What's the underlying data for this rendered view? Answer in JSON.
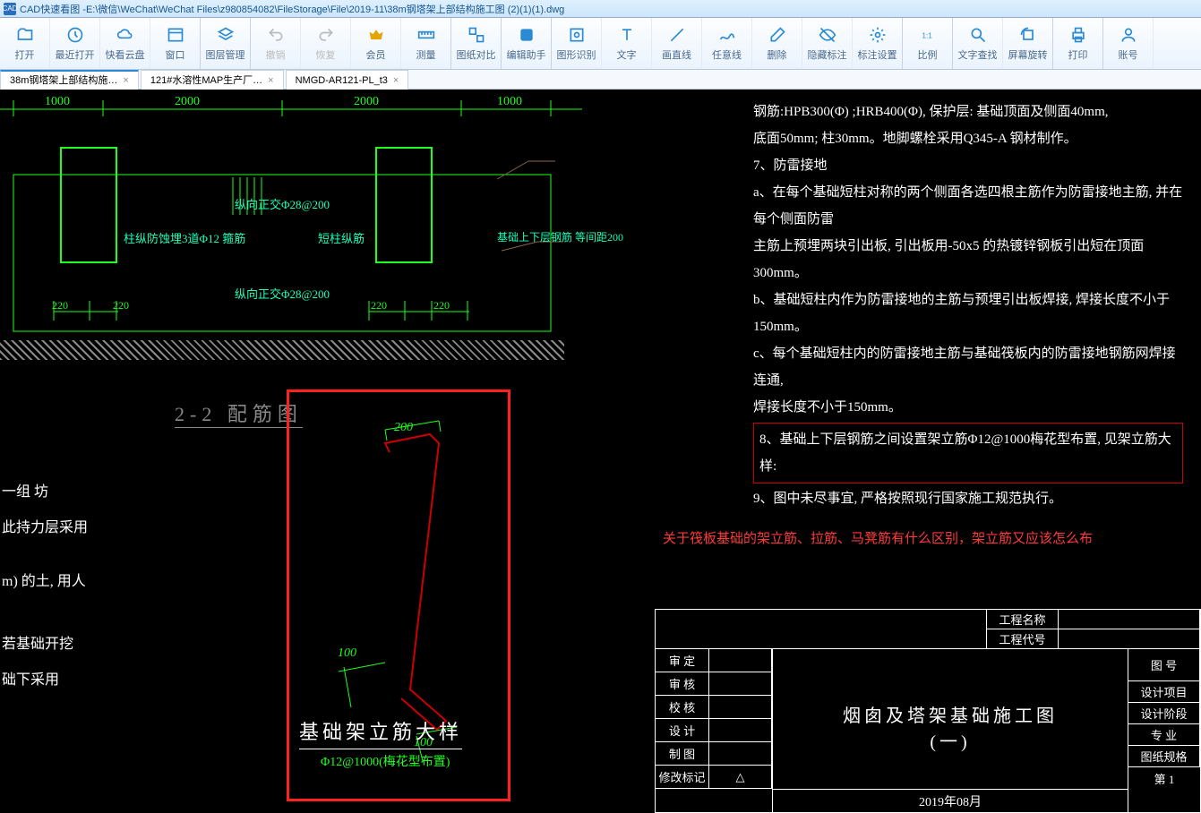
{
  "app": {
    "title_prefix": "CAD快速看图 - ",
    "file_path": "E:\\微信\\WeChat\\WeChat Files\\z980854082\\FileStorage\\File\\2019-11\\38m钢塔架上部结构施工图 (2)(1)(1).dwg",
    "logo_text": "CAD"
  },
  "toolbar": [
    {
      "id": "open",
      "label": "打开"
    },
    {
      "id": "recent",
      "label": "最近打开"
    },
    {
      "id": "cloud",
      "label": "快看云盘"
    },
    {
      "id": "window",
      "label": "窗口",
      "sep": true
    },
    {
      "id": "layers",
      "label": "图层管理",
      "sep": true
    },
    {
      "id": "undo",
      "label": "撤销",
      "disabled": true
    },
    {
      "id": "redo",
      "label": "恢复",
      "disabled": true
    },
    {
      "id": "vip",
      "label": "会员",
      "vip": true
    },
    {
      "id": "measure",
      "label": "测量",
      "sep": true
    },
    {
      "id": "compare",
      "label": "图纸对比",
      "sep": true
    },
    {
      "id": "helper",
      "label": "编辑助手",
      "sep": true
    },
    {
      "id": "ocr",
      "label": "图形识别"
    },
    {
      "id": "text",
      "label": "文字"
    },
    {
      "id": "line",
      "label": "画直线"
    },
    {
      "id": "polyline",
      "label": "任意线"
    },
    {
      "id": "erase",
      "label": "删除"
    },
    {
      "id": "hidemark",
      "label": "隐藏标注"
    },
    {
      "id": "dimset",
      "label": "标注设置",
      "sep": true
    },
    {
      "id": "scale",
      "label": "比例",
      "sep": true
    },
    {
      "id": "find",
      "label": "文字查找"
    },
    {
      "id": "rotate",
      "label": "屏幕旋转",
      "sep": true
    },
    {
      "id": "print",
      "label": "打印",
      "sep": true
    },
    {
      "id": "account",
      "label": "账号"
    }
  ],
  "tabs": [
    {
      "label": "38m钢塔架上部结构施…",
      "active": true
    },
    {
      "label": "121#水溶性MAP生产厂…",
      "active": false
    },
    {
      "label": "NMGD-AR121-PL_t3",
      "active": false
    }
  ],
  "top_dims": {
    "d1": "1000",
    "d2": "2000",
    "d3": "2000",
    "d4": "1000",
    "r1": "220",
    "r2": "220",
    "r3": "220",
    "r4": "220"
  },
  "top_labels": {
    "a": "纵向正交Φ28@200",
    "b": "柱纵防蚀埋3道Φ12 箍筋",
    "c": "短柱纵筋",
    "d": "基础上下层钢筋 等间距200",
    "e": "纵向正交Φ28@200"
  },
  "section_title": "2-2 配筋图",
  "notes": {
    "n6": "钢筋:HPB300(Φ) ;HRB400(Φ), 保护层: 基础顶面及侧面40mm,",
    "n6b": "底面50mm; 柱30mm。地脚螺栓采用Q345-A 钢材制作。",
    "n7": "7、防雷接地",
    "n7a": "a、在每个基础短柱对称的两个侧面各选四根主筋作为防雷接地主筋, 并在每个侧面防雷",
    "n7a2": "主筋上预埋两块引出板, 引出板用-50x5 的热镀锌钢板引出短在顶面300mm。",
    "n7b": "b、基础短柱内作为防雷接地的主筋与预埋引出板焊接, 焊接长度不小于150mm。",
    "n7c": "c、每个基础短柱内的防雷接地主筋与基础筏板内的防雷接地钢筋网焊接连通,",
    "n7c2": "焊接长度不小于150mm。",
    "n8": "8、基础上下层钢筋之间设置架立筋Φ12@1000梅花型布置, 见架立筋大样:",
    "n9": "9、图中未尽事宜, 严格按照现行国家施工规范执行。"
  },
  "red_question": "关于筏板基础的架立筋、拉筋、马凳筋有什么区别，架立筋又应该怎么布",
  "detail": {
    "d200": "200",
    "d100a": "100",
    "d100b": "100",
    "title": "基础架立筋大样",
    "sub": "Φ12@1000(梅花型布置)"
  },
  "left_notes": {
    "a": "一组 坊",
    "b": "此持力层采用",
    "c": "m) 的土, 用人",
    "d": "若基础开挖",
    "e": "础下采用"
  },
  "titleblock": {
    "labels": {
      "gcmc": "工程名称",
      "gcdh": "工程代号",
      "sd": "审 定",
      "sh": "审 核",
      "jh": "校 核",
      "sj": "设 计",
      "zt": "制 图",
      "xgbj": "修改标记"
    },
    "right": {
      "th": "图 号",
      "sjxm": "设计项目",
      "sjjd": "设计阶段",
      "zy": "专 业",
      "tzgg": "图纸规格",
      "page": "第 1"
    },
    "center": {
      "line1": "烟囱及塔架基础施工图",
      "line2": "(一)"
    },
    "date": "2019年08月",
    "tri": "△"
  },
  "colors": {
    "green": "#1dff1d",
    "cyan": "#1dffbb",
    "red": "#ff2020",
    "brown": "#864"
  }
}
